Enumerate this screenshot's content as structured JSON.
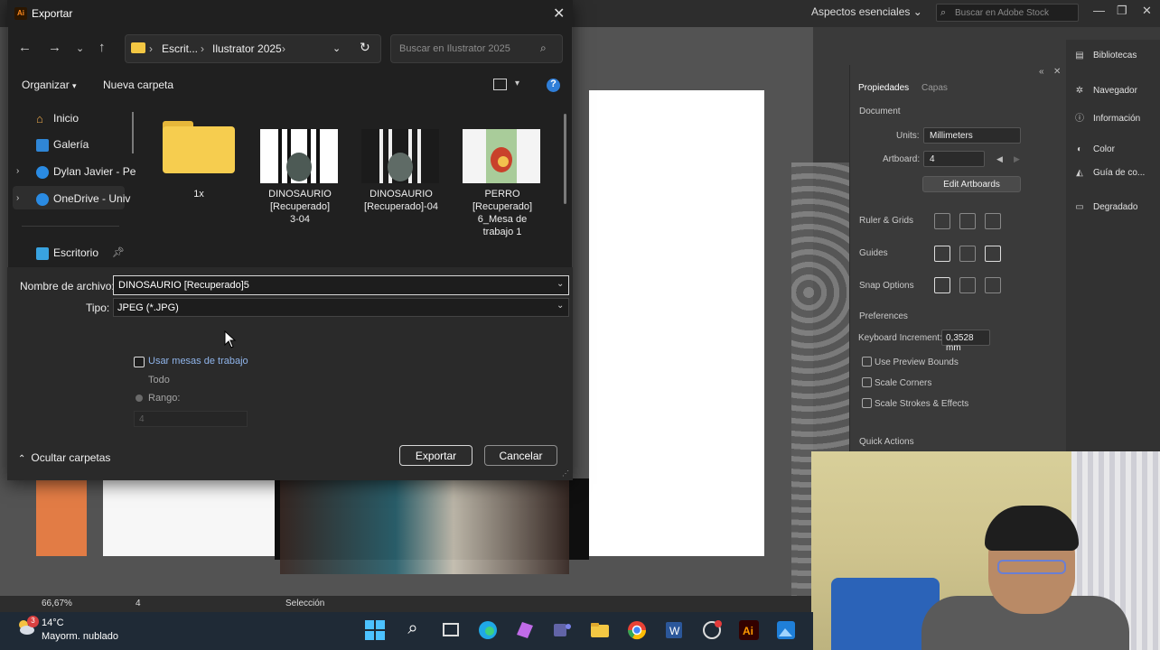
{
  "illustrator": {
    "workspace": "Aspectos esenciales",
    "search_placeholder": "Buscar en Adobe Stock",
    "zoom": "66,67%",
    "artboard_nav": "4",
    "tool_status": "Selección",
    "properties": {
      "tabs": [
        "Propiedades",
        "Capas"
      ],
      "document_label": "Document",
      "units_label": "Units:",
      "units_value": "Millimeters",
      "artboard_label": "Artboard:",
      "artboard_value": "4",
      "edit_artboards": "Edit Artboards",
      "ruler_grids": "Ruler & Grids",
      "guides": "Guides",
      "snap_options": "Snap Options",
      "preferences": "Preferences",
      "keyboard_increment_label": "Keyboard Increment:",
      "keyboard_increment_value": "0,3528 mm",
      "use_preview_bounds": "Use Preview Bounds",
      "scale_corners": "Scale Corners",
      "scale_strokes": "Scale Strokes & Effects",
      "quick_actions": "Quick Actions"
    },
    "dock": [
      "Bibliotecas",
      "Navegador",
      "Información",
      "Color",
      "Guía de co...",
      "Degradado"
    ]
  },
  "dialog": {
    "app_icon": "Ai",
    "title": "Exportar",
    "address": {
      "part1": "Escrit...",
      "part2": "Ilustrator 2025"
    },
    "search_placeholder": "Buscar en Ilustrator 2025",
    "toolbar": {
      "organize": "Organizar",
      "new_folder": "Nueva carpeta"
    },
    "nav": [
      "Inicio",
      "Galería",
      "Dylan Javier - Pe",
      "OneDrive - Univ",
      "Escritorio"
    ],
    "files": [
      {
        "label": "1x",
        "type": "folder"
      },
      {
        "label": "DINOSAURIO\n[Recuperado]\n3-04",
        "type": "image"
      },
      {
        "label": "DINOSAURIO\n[Recuperado]-04",
        "type": "image"
      },
      {
        "label": "PERRO\n[Recuperado]\n6_Mesa de\ntrabajo 1",
        "type": "image"
      }
    ],
    "filename_label": "Nombre de archivo:",
    "filename_value": "DINOSAURIO [Recuperado]5",
    "type_label": "Tipo:",
    "type_value": "JPEG (*.JPG)",
    "use_artboards": "Usar mesas de trabajo",
    "all": "Todo",
    "range": "Rango:",
    "range_value": "4",
    "hide_folders": "Ocultar carpetas",
    "export_button": "Exportar",
    "cancel_button": "Cancelar"
  },
  "taskbar": {
    "temperature": "14°C",
    "weather": "Mayorm. nublado",
    "badge": "3"
  },
  "colors": {
    "dialog_bg": "#202020",
    "accent_link": "#8fb4ea",
    "folder_yellow": "#f3c743",
    "ai_orange": "#ff8a1e"
  }
}
